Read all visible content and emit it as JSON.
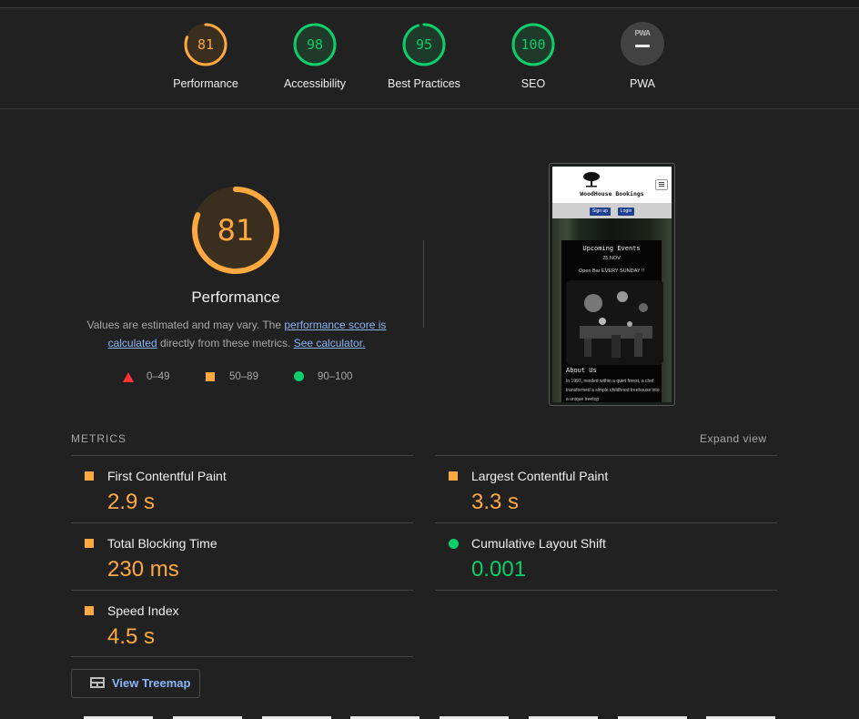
{
  "gauges": [
    {
      "score": "81",
      "label": "Performance",
      "status": "average",
      "fraction": 0.81
    },
    {
      "score": "98",
      "label": "Accessibility",
      "status": "pass",
      "fraction": 0.98
    },
    {
      "score": "95",
      "label": "Best Practices",
      "status": "pass",
      "fraction": 0.95
    },
    {
      "score": "100",
      "label": "SEO",
      "status": "pass",
      "fraction": 1.0
    },
    {
      "score": "PWA",
      "label": "PWA",
      "status": "na"
    }
  ],
  "colors": {
    "average": "#ffa940",
    "average_bg": "#3a2e1f",
    "pass": "#0cce6b",
    "pass_bg": "#1e3a2a",
    "fail": "#ff3333",
    "link": "#8ab4f8",
    "background": "#212121"
  },
  "main": {
    "score": "81",
    "fraction": 0.81,
    "title": "Performance",
    "desc_prefix": "Values are estimated and may vary. The ",
    "link_score": "performance score is calculated",
    "desc_middle": " directly from these metrics. ",
    "link_calc": "See calculator."
  },
  "legend": {
    "fail": "0–49",
    "average": "50–89",
    "pass": "90–100"
  },
  "screenshot": {
    "site_title": "WoodHouse Bookings",
    "signup": "Sign up",
    "login": "Login",
    "events_heading": "Upcoming Events",
    "event_date": "25 NOV",
    "event_name": "Open Bar EVERY SUNDAY !!",
    "about_heading": "About Us",
    "about_text": "In 1997, nestled within a quiet forest, a chef transformed a simple childhood treehouse into a unique treetop"
  },
  "metrics": {
    "header": "METRICS",
    "expand": "Expand view",
    "items": [
      {
        "name": "First Contentful Paint",
        "value": "2.9 s",
        "status": "average"
      },
      {
        "name": "Largest Contentful Paint",
        "value": "3.3 s",
        "status": "average"
      },
      {
        "name": "Total Blocking Time",
        "value": "230 ms",
        "status": "average"
      },
      {
        "name": "Cumulative Layout Shift",
        "value": "0.001",
        "status": "pass"
      },
      {
        "name": "Speed Index",
        "value": "4.5 s",
        "status": "average"
      }
    ]
  },
  "treemap": {
    "label": "View Treemap"
  }
}
